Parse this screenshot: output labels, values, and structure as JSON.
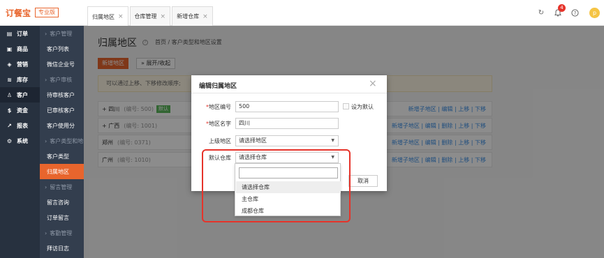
{
  "app": {
    "logo_text": "订餐宝",
    "edition": "专业版",
    "notification_count": "4",
    "avatar_letter": "p"
  },
  "tabs": [
    {
      "label": "归属地区"
    },
    {
      "label": "仓库管理"
    },
    {
      "label": "新增仓库"
    }
  ],
  "tab_close": "×",
  "sidebar": [
    {
      "label": "订单",
      "icon": "order-icon"
    },
    {
      "label": "商品",
      "icon": "goods-icon"
    },
    {
      "label": "营销",
      "icon": "marketing-icon"
    },
    {
      "label": "库存",
      "icon": "stock-icon"
    },
    {
      "label": "客户",
      "icon": "customer-icon"
    },
    {
      "label": "资金",
      "icon": "money-icon"
    },
    {
      "label": "报表",
      "icon": "report-icon"
    },
    {
      "label": "系统",
      "icon": "system-icon"
    }
  ],
  "subnav": [
    {
      "label": "客户管理",
      "group": true
    },
    {
      "label": "客户列表"
    },
    {
      "label": "微信企业号"
    },
    {
      "label": "客户审核",
      "group": true
    },
    {
      "label": "待审核客户"
    },
    {
      "label": "已审核客户"
    },
    {
      "label": "客户使用分"
    },
    {
      "label": "客户类型和地区",
      "group": true
    },
    {
      "label": "客户类型"
    },
    {
      "label": "归属地区",
      "active": true
    },
    {
      "label": "留言管理",
      "group": true
    },
    {
      "label": "留言咨询"
    },
    {
      "label": "订单留言"
    },
    {
      "label": "客勤管理",
      "group": true
    },
    {
      "label": "拜访日志"
    }
  ],
  "page": {
    "title": "归属地区",
    "breadcrumb": "首页 / 客户类型和地区设置",
    "add_button": "新增地区",
    "toggle_button": "» 展开/收起",
    "hint": "可以通过上移、下移修改顺序;"
  },
  "rows": [
    {
      "name": "+ 四川",
      "code": "(编号: 500)",
      "tag": "默认",
      "ops": "新增子地区 | 编辑 | 上移 | 下移"
    },
    {
      "name": "+ 广西",
      "code": "(编号: 1001)",
      "tag": "",
      "ops": "新增子地区 | 编辑 | 删除 | 上移 | 下移"
    },
    {
      "name": "郑州",
      "code": "(编号: 0371)",
      "tag": "",
      "ops": "新增子地区 | 编辑 | 删除 | 上移 | 下移"
    },
    {
      "name": "广州",
      "code": "(编号: 1010)",
      "tag": "",
      "ops": "新增子地区 | 编辑 | 删除 | 上移 | 下移"
    }
  ],
  "modal": {
    "title": "编辑归属地区",
    "close": "×",
    "code_label": "地区编号",
    "code_value": "500",
    "default_label": "设为默认",
    "name_label": "地区名字",
    "name_value": "四川",
    "parent_label": "上级地区",
    "parent_value": "请选择地区",
    "warehouse_label": "默认仓库",
    "warehouse_value": "请选择仓库",
    "required_mark": "*",
    "cancel": "取消"
  },
  "dropdown": {
    "options": [
      "请选择仓库",
      "主仓库",
      "成都仓库"
    ],
    "selected_index": 0
  },
  "colors": {
    "accent": "#e8652d",
    "sidebar": "#27313f",
    "subnav": "#333e4e",
    "link": "#3a8ee6",
    "highlight": "#e6332a"
  }
}
